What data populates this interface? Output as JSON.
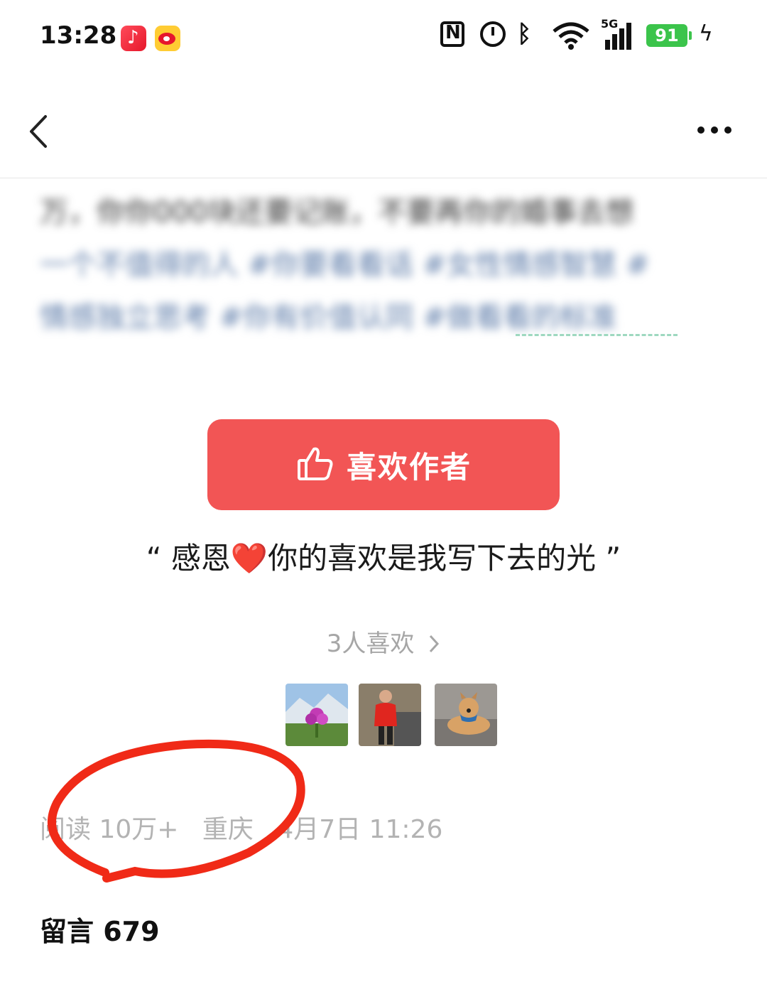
{
  "status_bar": {
    "time": "13:28",
    "network": "5G",
    "battery": "91",
    "icons": [
      "music-app-icon",
      "weibo-app-icon",
      "nfc-icon",
      "alarm-icon",
      "bluetooth-icon",
      "wifi-icon",
      "signal-icon",
      "battery-icon",
      "charging-icon"
    ]
  },
  "nav": {
    "back_icon": "chevron-left-icon",
    "more_icon": "more-dots-icon"
  },
  "article": {
    "blurred_lines": [
      "万，你你000块还要记账，不要再你的婚事去想",
      "一个不值得的人 #你要看看话 #女性情感智慧 #",
      "情感独立思考 #你有价值认同 #做看看的标准"
    ]
  },
  "like": {
    "button_label": "喜欢作者",
    "thanks_open": "“ 感恩",
    "heart": "❤️",
    "thanks_close": "你的喜欢是我写下去的光 ”",
    "likes_count": "3人喜欢",
    "accent": "#f25555"
  },
  "meta": {
    "reads": "阅读 10万+",
    "location": "重庆",
    "date": "4月7日 11:26"
  },
  "comments": {
    "label": "留言 679"
  }
}
